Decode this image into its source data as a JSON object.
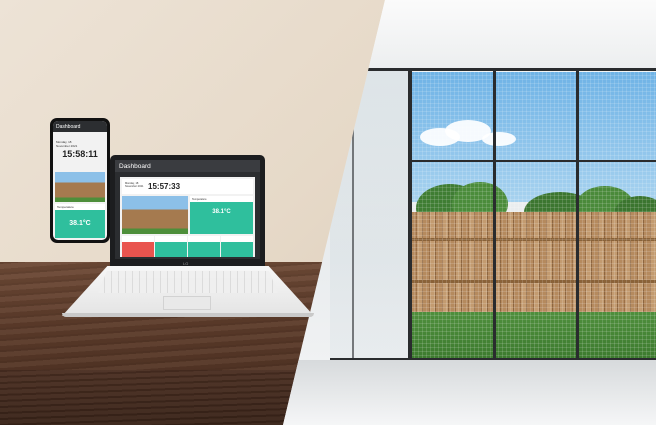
{
  "colors": {
    "dashboard_green": "#2fbf9d",
    "dashboard_red": "#e9544e",
    "device_dark": "#1c1d1f",
    "glass_frame": "#2a2c2e"
  },
  "phone": {
    "title": "Dashboard",
    "date_line1": "Monday, 18",
    "date_line2": "November 2021",
    "time": "15:58:11",
    "temperature_label": "Temperature",
    "temperature_value": "38.1°C"
  },
  "laptop": {
    "title": "Dashboard",
    "brand": "LG",
    "date_line1": "Monday, 18",
    "date_line2": "November 2021",
    "time": "15:57:33",
    "temperature_label": "Temperature",
    "temperature_value": "38.1°C"
  }
}
